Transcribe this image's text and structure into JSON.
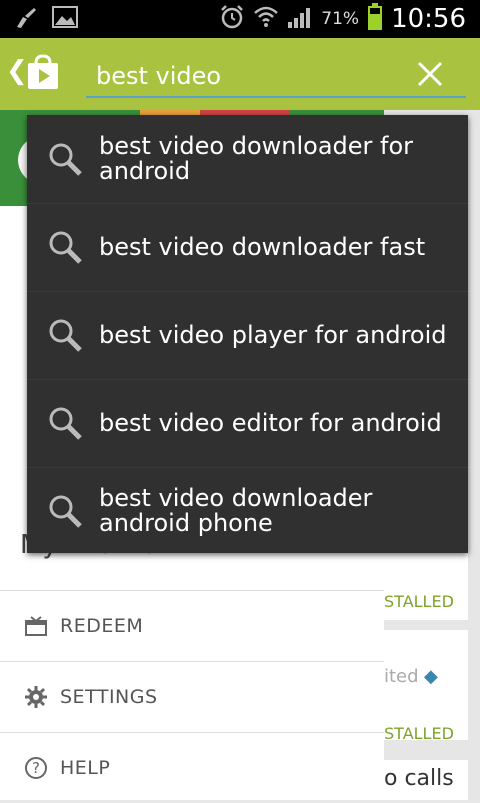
{
  "status_bar": {
    "battery_percent": "71%",
    "time": "10:56"
  },
  "search": {
    "value": "best video"
  },
  "suggestions": [
    {
      "text": "best video downloader for android"
    },
    {
      "text": "best video downloader fast"
    },
    {
      "text": "best video player for android"
    },
    {
      "text": "best video editor for android"
    },
    {
      "text": "best video downloader android phone"
    }
  ],
  "drawer": {
    "partial_wishlist": "My Wishlist",
    "items": [
      {
        "label": "REDEEM",
        "icon": "gift-icon"
      },
      {
        "label": "SETTINGS",
        "icon": "gear-icon"
      },
      {
        "label": "HELP",
        "icon": "help-icon"
      }
    ]
  },
  "cards": {
    "installed_1": "STALLED",
    "installed_2": "STALLED",
    "partial_1": "ited",
    "partial_2": "o calls"
  },
  "colors": {
    "app_bar": "#a9c23f",
    "search_underline": "#5aa3c8",
    "dropdown_bg": "#303030",
    "installed_green": "#7ea32a"
  }
}
